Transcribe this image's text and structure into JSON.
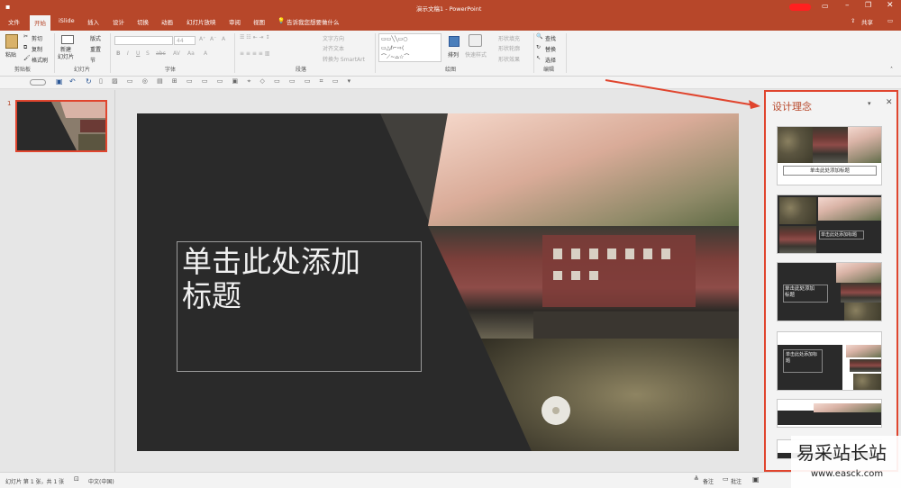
{
  "window": {
    "title": "演示文稿1 - PowerPoint",
    "share_label": "共享"
  },
  "tabs": [
    "文件",
    "开始",
    "iSlide",
    "插入",
    "设计",
    "切换",
    "动画",
    "幻灯片放映",
    "审阅",
    "视图"
  ],
  "tell_me": "告诉我您想要做什么",
  "ribbon": {
    "clipboard": {
      "paste": "粘贴",
      "cut": "剪切",
      "copy": "复制",
      "format_painter": "格式刷",
      "group": "剪贴板"
    },
    "slides": {
      "new_slide": "新建\n幻灯片",
      "layout": "版式",
      "reset": "重置",
      "section": "节",
      "group": "幻灯片"
    },
    "font": {
      "font_size": "44",
      "group": "字体"
    },
    "paragraph": {
      "text_direction": "文字方向",
      "align_text": "对齐文本",
      "smartart": "转换为 SmartArt",
      "group": "段落"
    },
    "drawing": {
      "arrange": "排列",
      "quick_styles": "快速样式",
      "shape_fill": "形状填充",
      "shape_outline": "形状轮廓",
      "shape_effects": "形状效果",
      "group": "绘图"
    },
    "editing": {
      "find": "查找",
      "replace": "替换",
      "select": "选择",
      "group": "编辑"
    }
  },
  "slide_panel": {
    "slide_number": "1"
  },
  "slide": {
    "title_placeholder": "单击此处添加\n标题"
  },
  "design_pane": {
    "title": "设计理念",
    "thumbs": [
      {
        "label": "单击此处添加标题"
      },
      {
        "label": "单击此处添加标题"
      },
      {
        "label": "单击此处添加\n标题"
      },
      {
        "label": "单击此处添加标\n题"
      },
      {
        "label": ""
      }
    ]
  },
  "status": {
    "slide_info": "幻灯片 第 1 张，共 1 张",
    "language": "中文(中国)",
    "notes": "备注",
    "comments": "批注"
  },
  "watermark": {
    "site": "易采站长站",
    "url": "www.easck.com"
  },
  "colors": {
    "accent": "#b7472a",
    "highlight_border": "#e0452e",
    "arrow": "#e0452e"
  }
}
